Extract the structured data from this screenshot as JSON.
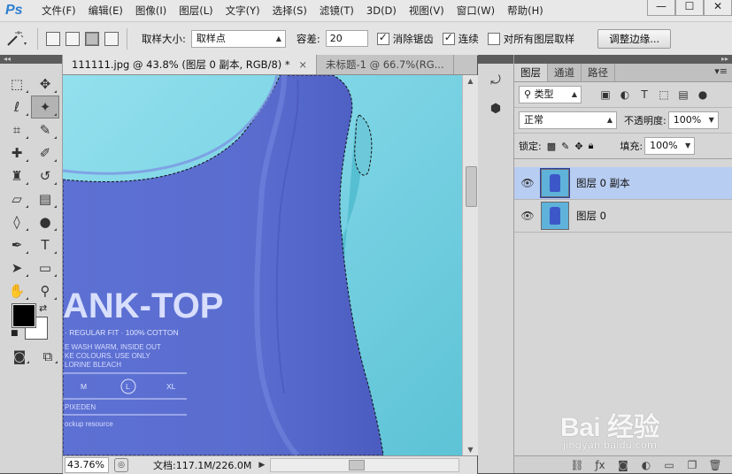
{
  "app": {
    "logo": "Ps"
  },
  "menu": [
    "文件(F)",
    "编辑(E)",
    "图像(I)",
    "图层(L)",
    "文字(Y)",
    "选择(S)",
    "滤镜(T)",
    "3D(D)",
    "视图(V)",
    "窗口(W)",
    "帮助(H)"
  ],
  "window_controls": {
    "minimize": "—",
    "maximize": "☐",
    "close": "✕"
  },
  "options": {
    "sample_size_label": "取样大小:",
    "sample_size_value": "取样点",
    "tolerance_label": "容差:",
    "tolerance_value": "20",
    "antialias_label": "消除锯齿",
    "antialias_checked": true,
    "contiguous_label": "连续",
    "contiguous_checked": true,
    "sample_all_label": "对所有图层取样",
    "sample_all_checked": false,
    "refine_edge_label": "调整边缘..."
  },
  "documents": {
    "tabs": [
      {
        "label": "111111.jpg @ 43.8% (图层 0 副本, RGB/8) *",
        "active": true
      },
      {
        "label": "未标题-1 @ 66.7%(RG...",
        "active": false
      }
    ],
    "canvas": {
      "shirt_text": "ANK-TOP",
      "shirt_subline": "· REGULAR FIT · 100% COTTON",
      "care_lines": [
        "E WASH WARM, INSIDE OUT",
        "KE COLOURS. USE ONLY",
        "LORINE BLEACH"
      ],
      "sizes": [
        "M",
        "L",
        "XL"
      ],
      "brand": "PIXEDEN",
      "footer": "ockup resource",
      "background_color": "#8ddcea",
      "shirt_color": "#5c6fd0"
    },
    "status": {
      "zoom": "43.76%",
      "doc_info": "文档:117.1M/226.0M"
    }
  },
  "layers_panel": {
    "tabs": [
      {
        "label": "图层",
        "active": true
      },
      {
        "label": "通道",
        "active": false
      },
      {
        "label": "路径",
        "active": false
      }
    ],
    "filter_kind": "类型",
    "blend_mode": "正常",
    "opacity_label": "不透明度:",
    "opacity_value": "100%",
    "lock_label": "锁定:",
    "fill_label": "填充:",
    "fill_value": "100%",
    "layers": [
      {
        "name": "图层 0 副本",
        "selected": true
      },
      {
        "name": "图层 0",
        "selected": false
      }
    ]
  },
  "watermark": {
    "logo": "Bai 经验",
    "url": "jingyan.baidu.com"
  }
}
